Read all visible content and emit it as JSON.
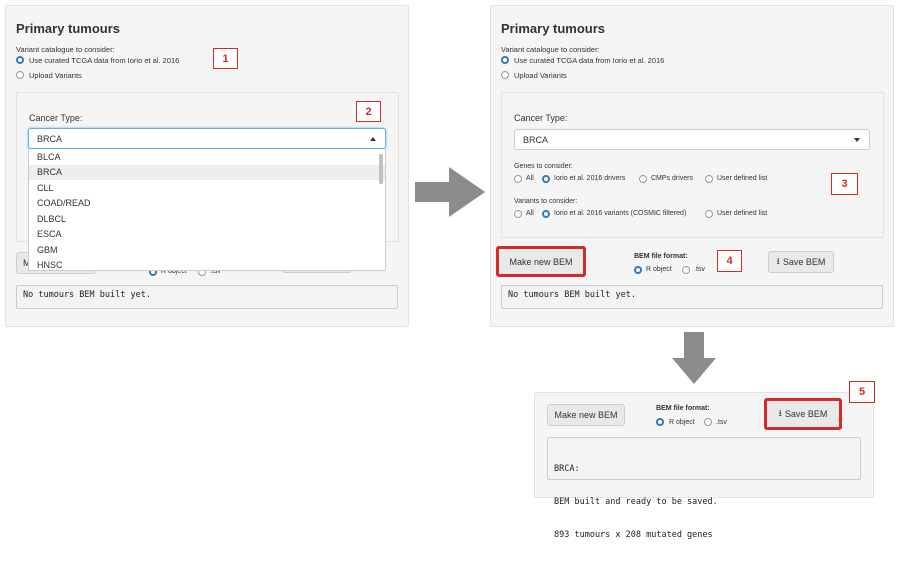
{
  "panel1": {
    "title": "Primary tumours",
    "variant_label": "Variant catalogue to consider:",
    "radio_curated": "Use curated TCGA data from Iorio et al. 2016",
    "radio_upload": "Upload Variants",
    "cancer_type_label": "Cancer Type:",
    "cancer_type_value": "BRCA",
    "dropdown_options": [
      "BLCA",
      "BRCA",
      "CLL",
      "COAD/READ",
      "DLBCL",
      "ESCA",
      "GBM",
      "HNSC"
    ],
    "selected_option": "BRCA",
    "make_button_partial": "Ma",
    "radio_r_partial": "R object",
    "radio_tsv_partial": ".tsv",
    "output_text": "No tumours BEM built yet."
  },
  "panel2": {
    "title": "Primary tumours",
    "variant_label": "Variant catalogue to consider:",
    "radio_curated": "Use curated TCGA data from Iorio et al. 2016",
    "radio_upload": "Upload Variants",
    "cancer_type_label": "Cancer Type:",
    "cancer_type_value": "BRCA",
    "genes_label": "Genes to consider:",
    "genes_options": [
      "All",
      "Iorio et al. 2016 drivers",
      "CMPs drivers",
      "User defined list"
    ],
    "variants_label": "Variants to consider:",
    "variants_options": [
      "All",
      "Iorio et al. 2016 variants (COSMIC filtered)",
      "User defined list"
    ],
    "make_button": "Make new BEM",
    "format_label": "BEM file format:",
    "format_r": "R object",
    "format_tsv": ".tsv",
    "save_button": "Save BEM",
    "output_text": "No tumours BEM built yet."
  },
  "panel3": {
    "make_button": "Make new BEM",
    "format_label": "BEM file format:",
    "format_r": "R object",
    "format_tsv": ".tsv",
    "save_button": "Save BEM",
    "output_lines": [
      "BRCA:",
      "BEM built and ready to be saved.",
      "893 tumours x 208 mutated genes"
    ]
  },
  "callouts": [
    "1",
    "2",
    "3",
    "4",
    "5"
  ],
  "colors": {
    "accent_red": "#d32b2b",
    "arrow_gray": "#8c8c8c",
    "radio_blue": "#337ab7"
  }
}
